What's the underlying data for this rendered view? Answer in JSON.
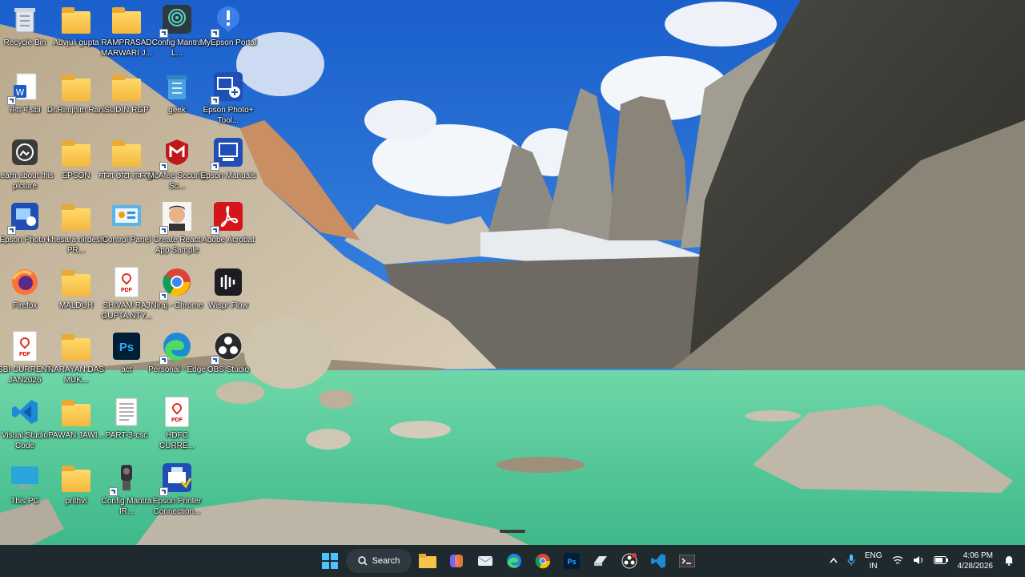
{
  "desktop": {
    "icons": [
      {
        "label": "Recycle Bin",
        "icon": "recycle-bin-icon"
      },
      {
        "label": "Advjuli gupta",
        "icon": "folder-icon"
      },
      {
        "label": "RAMPRASAD MARWARI J...",
        "icon": "folder-icon"
      },
      {
        "label": "Config Mantra L...",
        "icon": "fingerprint-icon"
      },
      {
        "label": "MyEpson Portal",
        "icon": "epson-portal-icon"
      },
      {
        "label": "सेवा में sbi",
        "icon": "word-doc-icon"
      },
      {
        "label": "Dr.Rimjhim Rani",
        "icon": "photo-folder-icon"
      },
      {
        "label": "SUDIN RGP",
        "icon": "folder-icon"
      },
      {
        "label": "geek",
        "icon": "recycle-bin-icon"
      },
      {
        "label": "Epson Photo+ Tool...",
        "icon": "epson-photo-tool-icon"
      },
      {
        "label": "Learn about this picture",
        "icon": "learn-picture-icon"
      },
      {
        "label": "EPSON",
        "icon": "folder-icon"
      },
      {
        "label": "मोजा छोटा शकरपुर",
        "icon": "folder-icon"
      },
      {
        "label": "McAfee Security Sc...",
        "icon": "mcafee-icon"
      },
      {
        "label": "Epson Manuals",
        "icon": "epson-manuals-icon"
      },
      {
        "label": "Epson Photo+",
        "icon": "epson-photo-icon"
      },
      {
        "label": "khesara nirdesh PR...",
        "icon": "folder-icon"
      },
      {
        "label": "Control Panel",
        "icon": "control-panel-icon"
      },
      {
        "label": "Create React App Sample",
        "icon": "avatar-icon"
      },
      {
        "label": "Adobe Acrobat",
        "icon": "acrobat-icon"
      },
      {
        "label": "Firefox",
        "icon": "firefox-icon"
      },
      {
        "label": "MALDUH",
        "icon": "folder-icon"
      },
      {
        "label": "SHIVAM RAJ GUPTA NTY...",
        "icon": "pdf-icon"
      },
      {
        "label": "Niraj - Chrome",
        "icon": "chrome-icon"
      },
      {
        "label": "Wispr Flow",
        "icon": "wispr-flow-icon"
      },
      {
        "label": "SBI CURRENT JAN2026",
        "icon": "pdf-icon"
      },
      {
        "label": "NARAYAN DAS MUK...",
        "icon": "folder-icon"
      },
      {
        "label": "act",
        "icon": "photoshop-icon"
      },
      {
        "label": "Personal - Edge",
        "icon": "edge-icon"
      },
      {
        "label": "OBS Studio",
        "icon": "obs-icon"
      },
      {
        "label": "Visual Studio Code",
        "icon": "vscode-icon"
      },
      {
        "label": "PAWAN JAWI...",
        "icon": "folder-icon"
      },
      {
        "label": "PART-3-csc",
        "icon": "document-icon"
      },
      {
        "label": "HDFC CURRE...",
        "icon": "pdf-icon"
      },
      {
        "label": "This PC",
        "icon": "this-pc-icon"
      },
      {
        "label": "prithvi",
        "icon": "folder-icon"
      },
      {
        "label": "Config Mantra IR...",
        "icon": "scanner-icon"
      },
      {
        "label": "Epson Printer Connection...",
        "icon": "epson-printer-icon"
      }
    ]
  },
  "taskbar": {
    "search_label": "Search",
    "apps": [
      "start-icon",
      "file-explorer-icon",
      "copilot-icon",
      "mail-icon",
      "edge-icon",
      "chrome-icon",
      "photoshop-icon",
      "storage-icon",
      "obs-icon",
      "vscode-icon",
      "terminal-icon"
    ],
    "tray": {
      "lang_top": "ENG",
      "lang_bottom": "IN",
      "time": "4:06 PM",
      "date": "4/28/2026"
    }
  },
  "colors": {
    "taskbar": "#1f2a2f",
    "sky": "#1f6fd6",
    "lake": "#4fc99a"
  }
}
